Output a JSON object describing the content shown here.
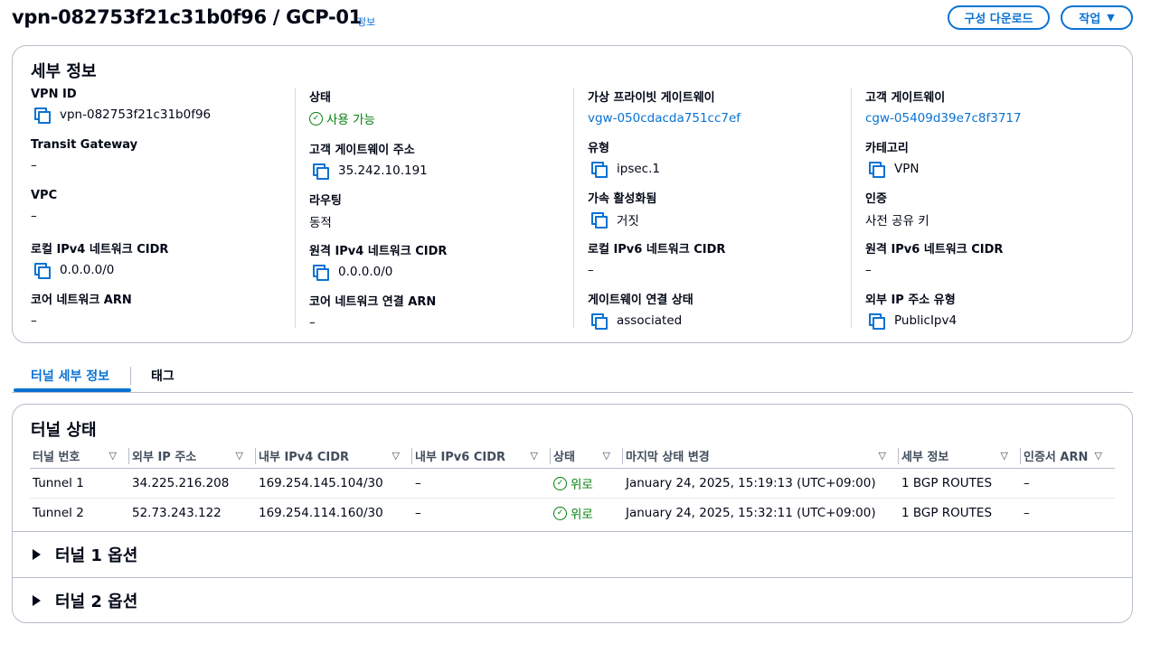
{
  "header": {
    "title": "vpn-082753f21c31b0f96 / GCP-01",
    "info": "정보",
    "download_button": "구성 다운로드",
    "action_button": "작업"
  },
  "details": {
    "title": "세부 정보",
    "columns": [
      [
        {
          "label": "VPN ID",
          "value": "vpn-082753f21c31b0f96",
          "copy": true
        },
        {
          "label": "Transit Gateway",
          "value": "–"
        },
        {
          "label": "VPC",
          "value": "–"
        },
        {
          "label": "로컬 IPv4 네트워크 CIDR",
          "value": "0.0.0.0/0",
          "copy": true
        },
        {
          "label": "코어 네트워크 ARN",
          "value": "–"
        }
      ],
      [
        {
          "label": "상태",
          "value": "사용 가능",
          "status": true
        },
        {
          "label": "고객 게이트웨이 주소",
          "value": "35.242.10.191",
          "copy": true
        },
        {
          "label": "라우팅",
          "value": "동적"
        },
        {
          "label": "원격 IPv4 네트워크 CIDR",
          "value": "0.0.0.0/0",
          "copy": true
        },
        {
          "label": "코어 네트워크 연결 ARN",
          "value": "–"
        }
      ],
      [
        {
          "label": "가상 프라이빗 게이트웨이",
          "value": "vgw-050cdacda751cc7ef",
          "link": true
        },
        {
          "label": "유형",
          "value": "ipsec.1",
          "copy": true
        },
        {
          "label": "가속 활성화됨",
          "value": "거짓",
          "copy": true
        },
        {
          "label": "로컬 IPv6 네트워크 CIDR",
          "value": "–"
        },
        {
          "label": "게이트웨이 연결 상태",
          "value": "associated",
          "copy": true
        }
      ],
      [
        {
          "label": "고객 게이트웨이",
          "value": "cgw-05409d39e7c8f3717",
          "link": true
        },
        {
          "label": "카테고리",
          "value": "VPN",
          "copy": true
        },
        {
          "label": "인증",
          "value": "사전 공유 키"
        },
        {
          "label": "원격 IPv6 네트워크 CIDR",
          "value": "–"
        },
        {
          "label": "외부 IP 주소 유형",
          "value": "PublicIpv4",
          "copy": true
        }
      ]
    ]
  },
  "tabs": [
    {
      "label": "터널 세부 정보",
      "active": true
    },
    {
      "label": "태그",
      "active": false
    }
  ],
  "tunnel_status": {
    "title": "터널 상태",
    "columns": [
      "터널 번호",
      "외부 IP 주소",
      "내부 IPv4 CIDR",
      "내부 IPv6 CIDR",
      "상태",
      "마지막 상태 변경",
      "세부 정보",
      "인증서 ARN"
    ],
    "rows": [
      [
        "Tunnel 1",
        "34.225.216.208",
        "169.254.145.104/30",
        "–",
        "위로",
        "January 24, 2025, 15:19:13 (UTC+09:00)",
        "1 BGP ROUTES",
        "–"
      ],
      [
        "Tunnel 2",
        "52.73.243.122",
        "169.254.114.160/30",
        "–",
        "위로",
        "January 24, 2025, 15:32:11 (UTC+09:00)",
        "1 BGP ROUTES",
        "–"
      ]
    ]
  },
  "expanders": [
    {
      "label": "터널 1 옵션"
    },
    {
      "label": "터널 2 옵션"
    }
  ],
  "colors": {
    "accent": "#0972d3",
    "success": "#037f0c",
    "border": "#b6bec9"
  }
}
